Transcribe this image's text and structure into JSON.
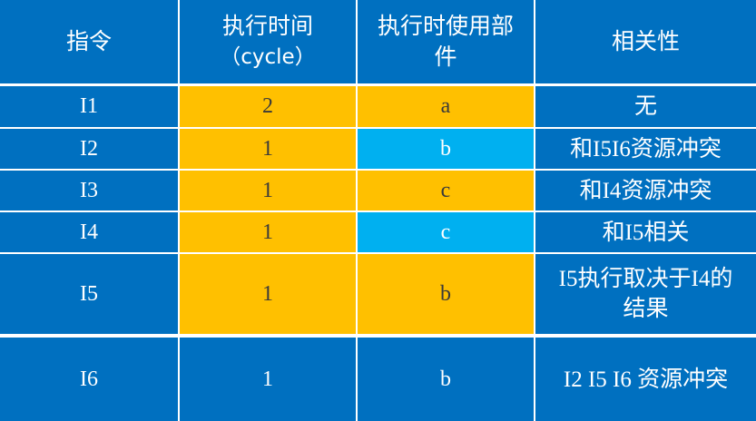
{
  "colors": {
    "blue": "#0070C0",
    "orange": "#FFC000",
    "cyan": "#00B0F0",
    "divider": "#FFFFFF",
    "text_light": "#FFFFFF",
    "text_dark": "#3A3A3A"
  },
  "table": {
    "headers": [
      {
        "lines": [
          "指令"
        ]
      },
      {
        "lines": [
          "执行时间",
          "（cycle）"
        ]
      },
      {
        "lines": [
          "执行时使用部",
          "件"
        ]
      },
      {
        "lines": [
          "相关性"
        ]
      }
    ],
    "rows": [
      {
        "instr": "I1",
        "cycles": "2",
        "unit": "a",
        "dependency": [
          "无"
        ],
        "cycles_fill": "#FFC000",
        "unit_fill": "#FFC000"
      },
      {
        "instr": "I2",
        "cycles": "1",
        "unit": "b",
        "dependency": [
          "和I5I6资源冲突"
        ],
        "cycles_fill": "#FFC000",
        "unit_fill": "#00B0F0"
      },
      {
        "instr": "I3",
        "cycles": "1",
        "unit": "c",
        "dependency": [
          "和I4资源冲突"
        ],
        "cycles_fill": "#FFC000",
        "unit_fill": "#FFC000"
      },
      {
        "instr": "I4",
        "cycles": "1",
        "unit": "c",
        "dependency": [
          "和I5相关"
        ],
        "cycles_fill": "#FFC000",
        "unit_fill": "#00B0F0"
      },
      {
        "instr": "I5",
        "cycles": "1",
        "unit": "b",
        "dependency": [
          "I5执行取决于I4的",
          "结果"
        ],
        "cycles_fill": "#FFC000",
        "unit_fill": "#FFC000"
      },
      {
        "instr": "I6",
        "cycles": "1",
        "unit": "b",
        "dependency": [
          "I2 I5 I6 资源冲突"
        ],
        "cycles_fill": "#0070C0",
        "unit_fill": "#0070C0"
      }
    ]
  }
}
